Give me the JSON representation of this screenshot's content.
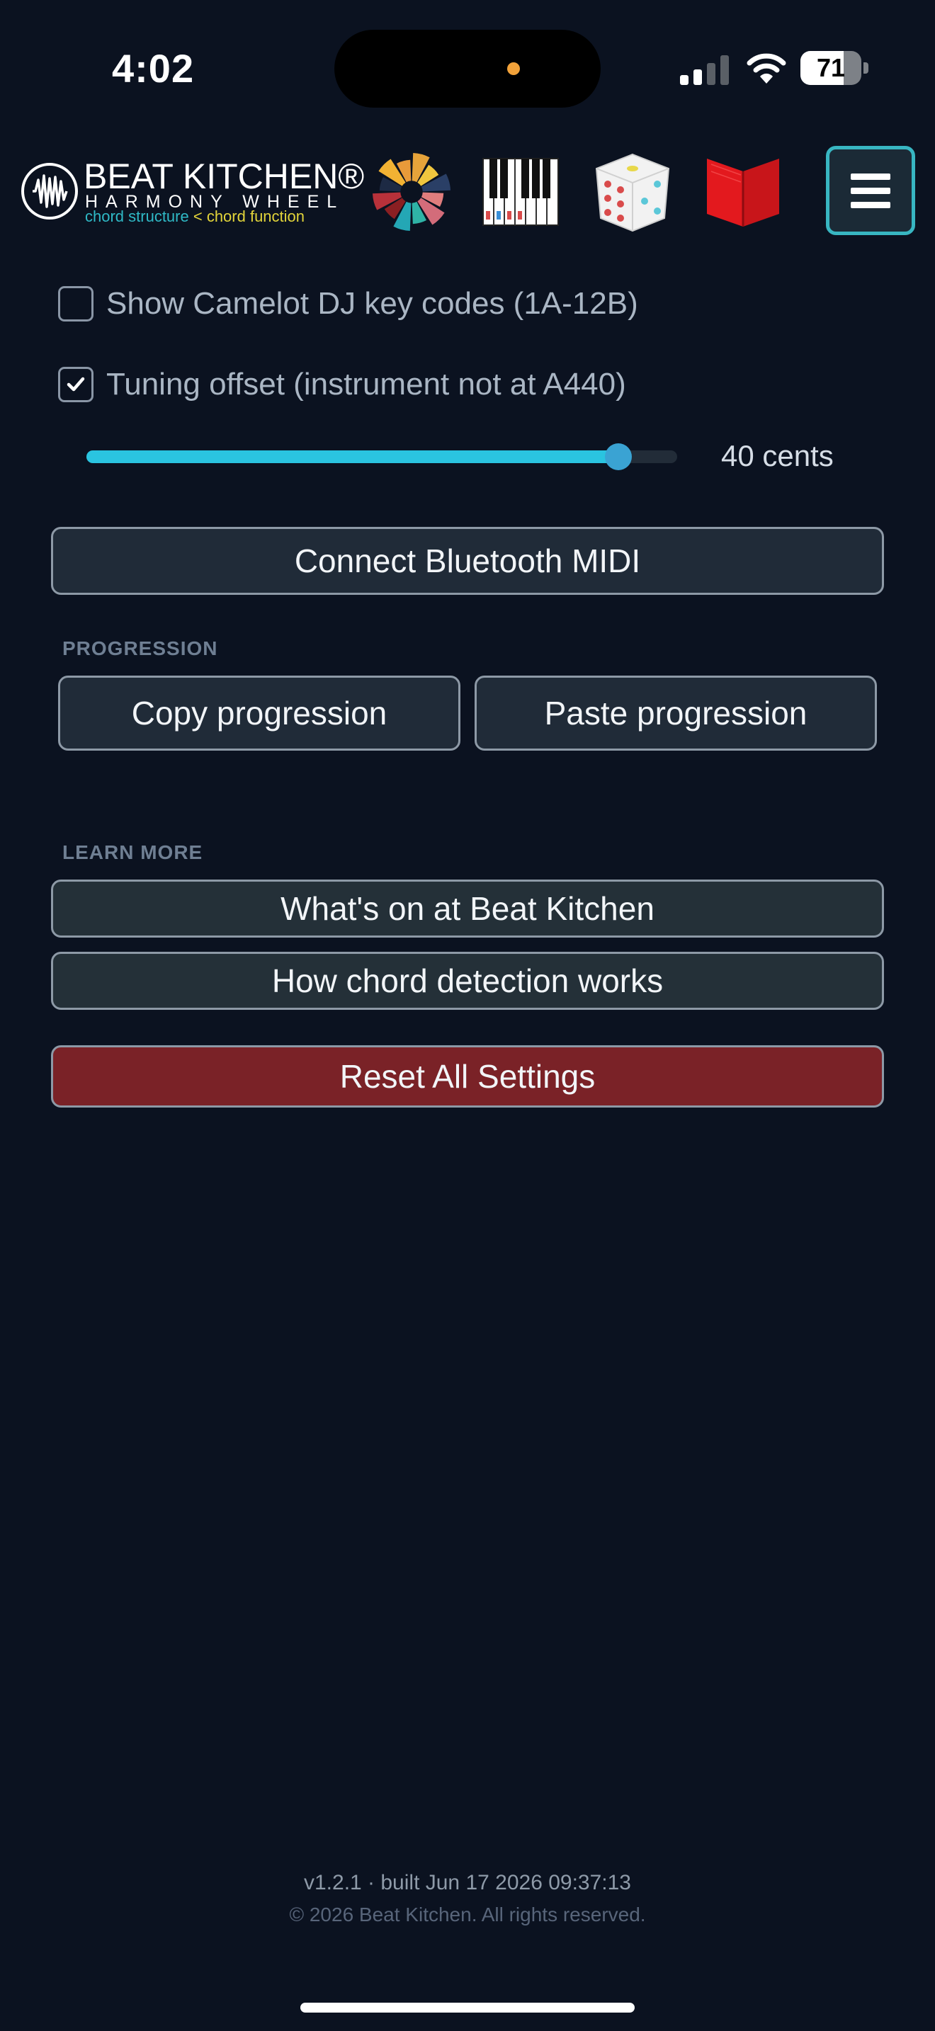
{
  "status_bar": {
    "time": "4:02",
    "battery": "71"
  },
  "header": {
    "brand": "BEAT KITCHEN®",
    "subtitle": "HARMONY WHEEL",
    "tagline_structure": "chord structure",
    "tagline_sep": " < ",
    "tagline_function": "chord function",
    "icons": [
      "color-wheel-icon",
      "piano-keys-icon",
      "dice-icon",
      "book-icon",
      "menu-icon"
    ]
  },
  "settings": {
    "camelot": {
      "label": "Show Camelot DJ key codes (1A-12B)",
      "checked": false
    },
    "tuning": {
      "label": "Tuning offset (instrument not at A440)",
      "checked": true
    },
    "tuning_slider": {
      "fraction": 0.9,
      "value_text": "40 cents"
    },
    "bluetooth_button": "Connect Bluetooth MIDI"
  },
  "progression": {
    "label": "PROGRESSION",
    "copy": "Copy progression",
    "paste": "Paste progression"
  },
  "learn_more": {
    "label": "LEARN MORE",
    "whats_on": "What's on at Beat Kitchen",
    "how_detection": "How chord detection works"
  },
  "reset_button": "Reset All Settings",
  "footer": {
    "version_line": "v1.2.1 · built Jun 17 2026 09:37:13",
    "copyright": "© 2026 Beat Kitchen. All rights reserved."
  },
  "colors": {
    "background": "#0b1220",
    "accent": "#2ac4e0",
    "reset": "#7a2227",
    "menu_border": "#38b6c2"
  }
}
